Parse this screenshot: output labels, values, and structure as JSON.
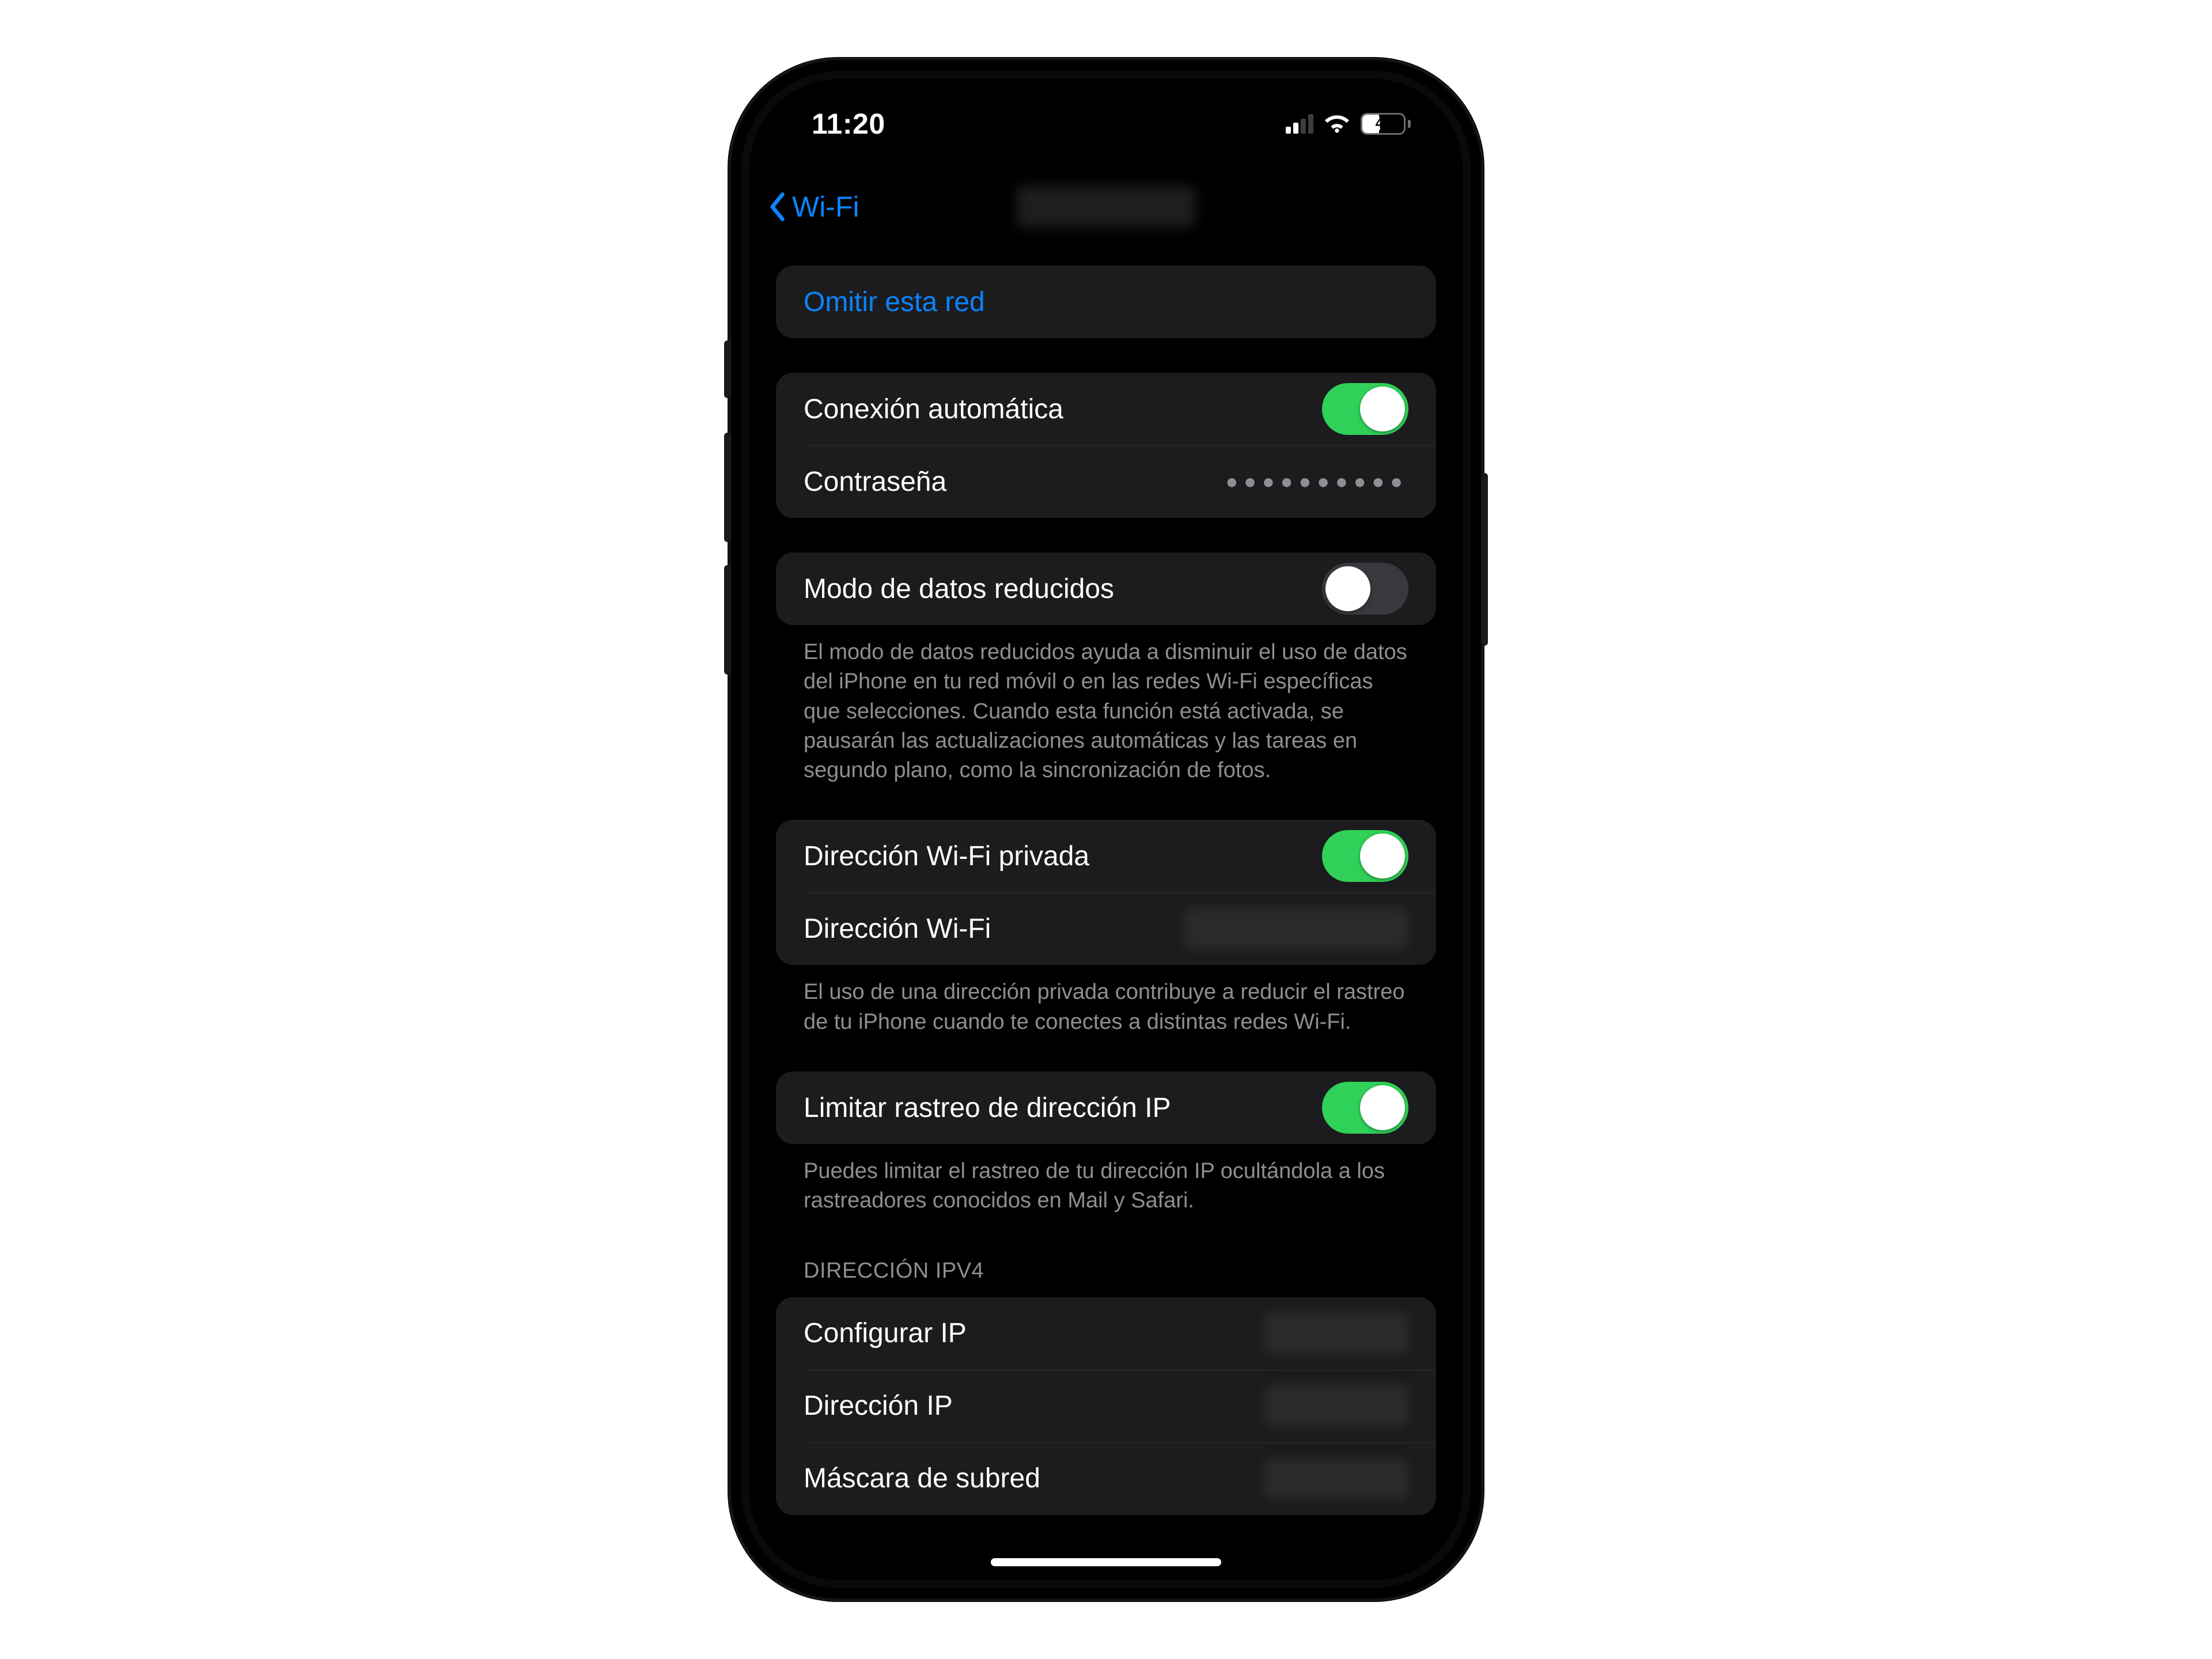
{
  "status": {
    "time": "11:20",
    "battery_pct": "40",
    "signal_active_bars": 2
  },
  "nav": {
    "back_label": "Wi-Fi"
  },
  "actions": {
    "forget_network": "Omitir esta red"
  },
  "auto_join": {
    "label": "Conexión automática",
    "on": true
  },
  "password": {
    "label": "Contraseña",
    "masked": "●●●●●●●●●●"
  },
  "low_data": {
    "label": "Modo de datos reducidos",
    "on": false,
    "footer": "El modo de datos reducidos ayuda a disminuir el uso de datos del iPhone en tu red móvil o en las redes Wi-Fi específicas que selecciones. Cuando esta función está activada, se pausarán las actualizaciones automáticas y las tareas en segundo plano, como la sincronización de fotos."
  },
  "private_addr": {
    "toggle_label": "Dirección Wi-Fi privada",
    "on": true,
    "address_label": "Dirección Wi-Fi",
    "footer": "El uso de una dirección privada contribuye a reducir el rastreo de tu iPhone cuando te conectes a distintas redes Wi-Fi."
  },
  "limit_ip": {
    "label": "Limitar rastreo de dirección IP",
    "on": true,
    "footer": "Puedes limitar el rastreo de tu dirección IP ocultándola a los rastreadores conocidos en Mail y Safari."
  },
  "ipv4": {
    "header": "DIRECCIÓN IPV4",
    "configure_label": "Configurar IP",
    "ip_label": "Dirección IP",
    "subnet_label": "Máscara de subred"
  }
}
